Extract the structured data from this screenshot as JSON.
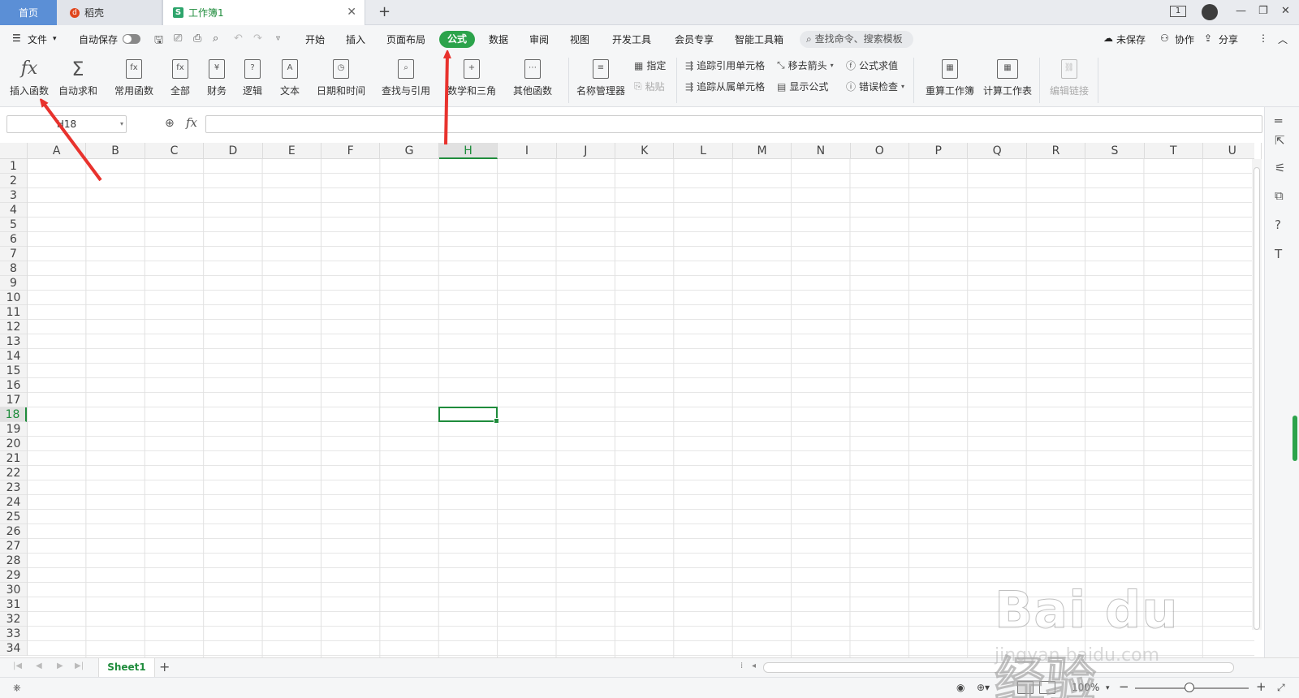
{
  "window": {
    "tabs": {
      "home": "首页",
      "docer": "稻壳",
      "workbook": "工作簿1"
    },
    "page_count": "1"
  },
  "menubar": {
    "file": "文件",
    "autosave": "自动保存",
    "items": [
      "开始",
      "插入",
      "页面布局",
      "公式",
      "数据",
      "审阅",
      "视图",
      "开发工具",
      "会员专享",
      "智能工具箱"
    ],
    "active_item": "公式",
    "search_placeholder": "查找命令、搜索模板",
    "unsaved": "未保存",
    "collaborate": "协作",
    "share": "分享"
  },
  "ribbon": {
    "insert_function": "插入函数",
    "autosum": "自动求和",
    "common_functions": "常用函数",
    "all": "全部",
    "finance": "财务",
    "logic": "逻辑",
    "text": "文本",
    "datetime": "日期和时间",
    "lookup": "查找与引用",
    "math": "数学和三角",
    "other": "其他函数",
    "name_manager": "名称管理器",
    "specify": "指定",
    "paste": "粘贴",
    "trace_precedents": "追踪引用单元格",
    "trace_dependents": "追踪从属单元格",
    "remove_arrows": "移去箭头",
    "show_formulas": "显示公式",
    "evaluate_formula": "公式求值",
    "error_check": "错误检查",
    "recalc_workbook": "重算工作簿",
    "calc_sheet": "计算工作表",
    "edit_links": "编辑链接"
  },
  "formula_bar": {
    "name_box": "H18",
    "fx_label": "fx",
    "content": ""
  },
  "grid": {
    "columns": [
      "A",
      "B",
      "C",
      "D",
      "E",
      "F",
      "G",
      "H",
      "I",
      "J",
      "K",
      "L",
      "M",
      "N",
      "O",
      "P",
      "Q",
      "R",
      "S",
      "T",
      "U"
    ],
    "rows": [
      "1",
      "2",
      "3",
      "4",
      "5",
      "6",
      "7",
      "8",
      "9",
      "10",
      "11",
      "12",
      "13",
      "14",
      "15",
      "16",
      "17",
      "18",
      "19",
      "20",
      "21",
      "22",
      "23",
      "24",
      "25",
      "26",
      "27",
      "28",
      "29",
      "30",
      "31",
      "32",
      "33",
      "34"
    ],
    "selected_column": "H",
    "selected_row": "18"
  },
  "sheets": {
    "tabs": [
      "Sheet1"
    ],
    "active": "Sheet1"
  },
  "statusbar": {
    "zoom": "100%"
  },
  "watermark": {
    "text": "Bai du 经验",
    "url": "jingyan.baidu.com"
  },
  "colors": {
    "accent_green": "#2ca34b",
    "annotation_red": "#e8322d",
    "home_tab_blue": "#5b8fd6"
  }
}
